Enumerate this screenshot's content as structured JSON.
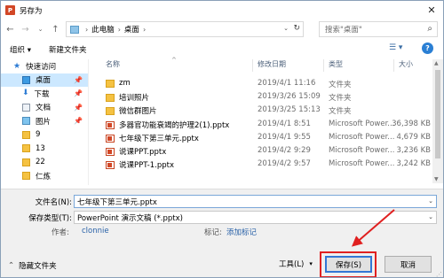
{
  "window": {
    "title": "另存为",
    "app_icon": "P",
    "close_glyph": "✕"
  },
  "nav": {
    "back": "←",
    "forward": "→",
    "up_dropdown": "⌄",
    "up": "↑",
    "breadcrumb": [
      "此电脑",
      "桌面"
    ],
    "separator": "›",
    "address_dropdown": "⌄",
    "refresh": "↻",
    "search_placeholder": "搜索\"桌面\"",
    "search_icon": "⌕"
  },
  "toolbar": {
    "organize": "组织 ▾",
    "new_folder": "新建文件夹",
    "view": "☰ ▾",
    "help": "?"
  },
  "sidebar": {
    "items": [
      {
        "label": "快速访问",
        "icon": "star-icon"
      },
      {
        "label": "桌面",
        "icon": "desktop-icon",
        "pinned": "📌",
        "selected": true
      },
      {
        "label": "下载",
        "icon": "download-icon",
        "pinned": "📌"
      },
      {
        "label": "文档",
        "icon": "documents-icon",
        "pinned": "📌"
      },
      {
        "label": "图片",
        "icon": "pictures-icon",
        "pinned": "📌"
      },
      {
        "label": "9",
        "icon": "folder-icon"
      },
      {
        "label": "13",
        "icon": "folder-icon"
      },
      {
        "label": "22",
        "icon": "folder-icon"
      },
      {
        "label": "仁炼",
        "icon": "folder-icon"
      }
    ]
  },
  "columns": {
    "name": "名称",
    "date": "修改日期",
    "type": "类型",
    "size": "大小",
    "sort_glyph": "^"
  },
  "files": [
    {
      "name": "zm",
      "date": "2019/4/1 11:16",
      "type": "文件夹",
      "size": "",
      "kind": "folder"
    },
    {
      "name": "培训照片",
      "date": "2019/3/26 15:09",
      "type": "文件夹",
      "size": "",
      "kind": "folder"
    },
    {
      "name": "微信群图片",
      "date": "2019/3/25 15:13",
      "type": "文件夹",
      "size": "",
      "kind": "folder"
    },
    {
      "name": "多器官功能衰竭的护理2(1).pptx",
      "date": "2019/4/1 8:51",
      "type": "Microsoft Power...",
      "size": "36,398 KB",
      "kind": "ppt"
    },
    {
      "name": "七年级下第三单元.pptx",
      "date": "2019/4/1 9:55",
      "type": "Microsoft Power...",
      "size": "4,679 KB",
      "kind": "ppt"
    },
    {
      "name": "说课PPT.pptx",
      "date": "2019/4/2 9:29",
      "type": "Microsoft Power...",
      "size": "3,236 KB",
      "kind": "ppt"
    },
    {
      "name": "说课PPT-1.pptx",
      "date": "2019/4/2 9:57",
      "type": "Microsoft Power...",
      "size": "3,242 KB",
      "kind": "ppt"
    }
  ],
  "form": {
    "filename_label": "文件名(N):",
    "filename_value": "七年级下第三单元.pptx",
    "filetype_label": "保存类型(T):",
    "filetype_value": "PowerPoint 演示文稿 (*.pptx)",
    "author_label": "作者:",
    "author_value": "clonnie",
    "tags_label": "标记:",
    "tags_value": "添加标记",
    "dropdown_glyph": "⌄"
  },
  "footer": {
    "hide_folders": "隐藏文件夹",
    "hide_folders_glyph": "⌃",
    "tools": "工具(L)",
    "tools_glyph": "▾",
    "save": "保存(S)",
    "cancel": "取消"
  },
  "colors": {
    "accent": "#3277d5",
    "highlight": "#e02020",
    "selection": "#cce8ff",
    "link": "#2a62a8"
  }
}
